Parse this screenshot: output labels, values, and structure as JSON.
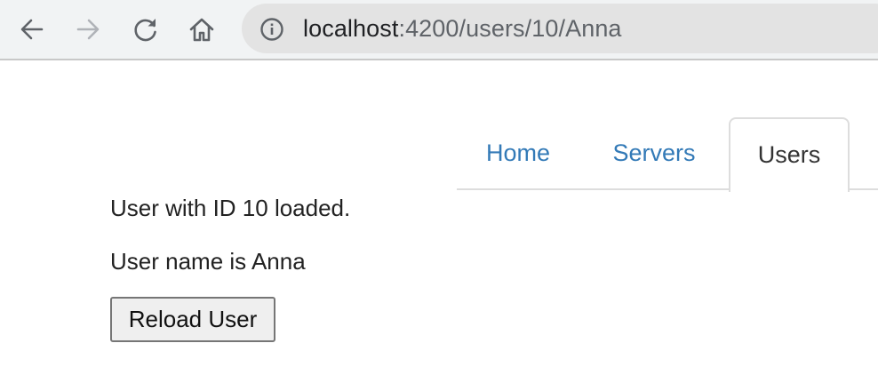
{
  "browser": {
    "url_host": "localhost",
    "url_path": ":4200/users/10/Anna",
    "icons": {
      "back": "back-arrow-icon",
      "forward": "forward-arrow-icon",
      "reload": "reload-icon",
      "home": "home-icon",
      "info": "info-icon"
    }
  },
  "nav": {
    "tabs": [
      {
        "label": "Home",
        "active": false
      },
      {
        "label": "Servers",
        "active": false
      },
      {
        "label": "Users",
        "active": true
      }
    ]
  },
  "user": {
    "loaded_message": "User with ID 10 loaded.",
    "name_message": "User name is Anna",
    "reload_label": "Reload User"
  },
  "colors": {
    "link": "#337ab7",
    "active_tab_text": "#333333",
    "toolbar_bg": "#f1f3f4",
    "address_bar_bg": "#e3e3e3"
  }
}
